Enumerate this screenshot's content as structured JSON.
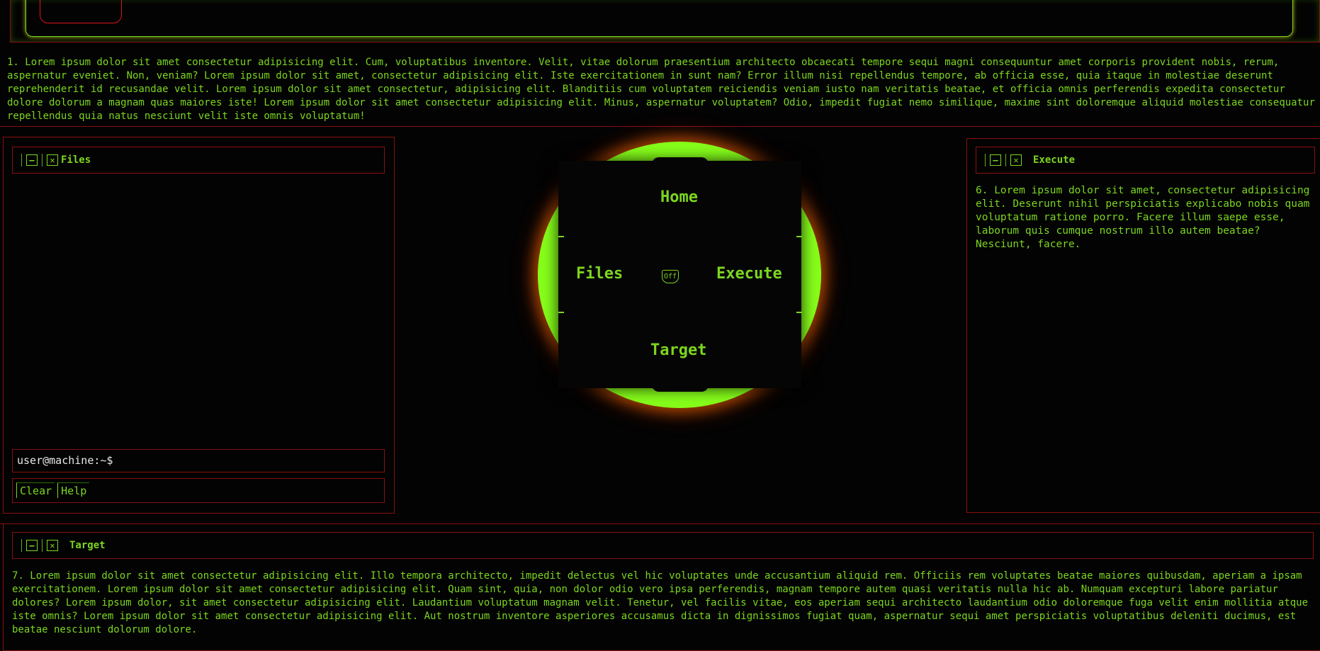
{
  "top_paragraph": "1. Lorem ipsum dolor sit amet consectetur adipisicing elit. Cum, voluptatibus inventore. Velit, vitae dolorum praesentium architecto obcaecati tempore sequi magni consequuntur amet corporis provident nobis, rerum, aspernatur eveniet. Non, veniam? Lorem ipsum dolor sit amet, consectetur adipisicing elit. Iste exercitationem in sunt nam? Error illum nisi repellendus tempore, ab officia esse, quia itaque in molestiae deserunt reprehenderit id recusandae velit. Lorem ipsum dolor sit amet consectetur, adipisicing elit. Blanditiis cum voluptatem reiciendis veniam iusto nam veritatis beatae, et officia omnis perferendis expedita consectetur dolore dolorum a magnam quas maiores iste! Lorem ipsum dolor sit amet consectetur adipisicing elit. Minus, aspernatur voluptatem? Odio, impedit fugiat nemo similique, maxime sint doloremque aliquid molestiae consequatur repellendus quia natus nesciunt velit iste omnis voluptatum!",
  "files_panel": {
    "title": "Files",
    "prompt": "user@machine:~$",
    "clear_label": "Clear",
    "help_label": "Help"
  },
  "nav": {
    "top": "Home",
    "left": "Files",
    "right": "Execute",
    "bottom": "Target",
    "center": "Off"
  },
  "execute_panel": {
    "title": "Execute",
    "text": "6. Lorem ipsum dolor sit amet, consectetur adipisicing elit. Deserunt nihil perspiciatis explicabo nobis quam voluptatum ratione porro. Facere illum saepe esse, laborum quis cumque nostrum illo autem beatae? Nesciunt, facere."
  },
  "target_panel": {
    "title": "Target",
    "text": "7. Lorem ipsum dolor sit amet consectetur adipisicing elit. Illo tempora architecto, impedit delectus vel hic voluptates unde accusantium aliquid rem. Officiis rem voluptates beatae maiores quibusdam, aperiam a ipsam exercitationem. Lorem ipsum dolor sit amet consectetur adipisicing elit. Quam sint, quia, non dolor odio vero ipsa perferendis, magnam tempore autem quasi veritatis nulla hic ab. Numquam excepturi labore pariatur dolores? Lorem ipsum dolor, sit amet consectetur adipisicing elit. Laudantium voluptatum magnam velit. Tenetur, vel facilis vitae, eos aperiam sequi architecto laudantium odio doloremque fuga velit enim mollitia atque iste omnis? Lorem ipsum dolor sit amet consectetur adipisicing elit. Aut nostrum inventore asperiores accusamus dicta in dignissimos fugiat quam, aspernatur sequi amet perspiciatis voluptatibus deleniti ducimus, est beatae nesciunt dolorum dolore."
  },
  "colors": {
    "accent": "#7cd61f",
    "glow_green": "#86ff1a",
    "border_red": "#8a0f0f",
    "background": "#030303"
  }
}
